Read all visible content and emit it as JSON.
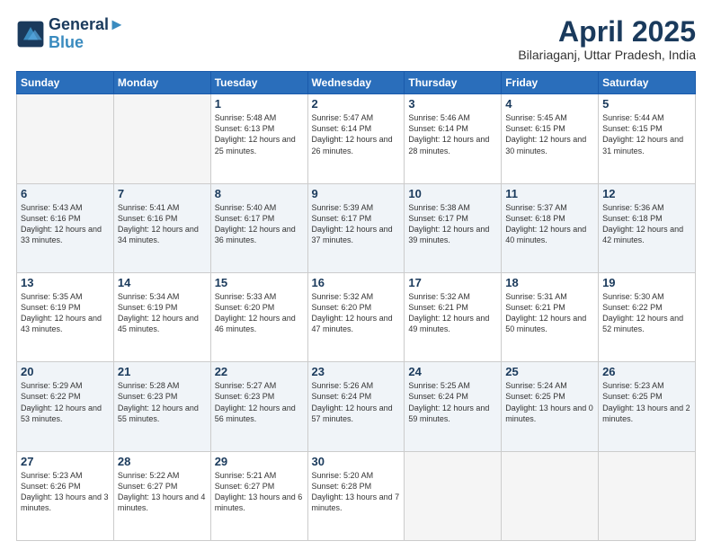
{
  "header": {
    "logo_line1": "General",
    "logo_line2": "Blue",
    "title": "April 2025",
    "subtitle": "Bilariaganj, Uttar Pradesh, India"
  },
  "days_of_week": [
    "Sunday",
    "Monday",
    "Tuesday",
    "Wednesday",
    "Thursday",
    "Friday",
    "Saturday"
  ],
  "weeks": [
    [
      {
        "day": "",
        "empty": true
      },
      {
        "day": "",
        "empty": true
      },
      {
        "day": "1",
        "sunrise": "5:48 AM",
        "sunset": "6:13 PM",
        "daylight": "12 hours and 25 minutes."
      },
      {
        "day": "2",
        "sunrise": "5:47 AM",
        "sunset": "6:14 PM",
        "daylight": "12 hours and 26 minutes."
      },
      {
        "day": "3",
        "sunrise": "5:46 AM",
        "sunset": "6:14 PM",
        "daylight": "12 hours and 28 minutes."
      },
      {
        "day": "4",
        "sunrise": "5:45 AM",
        "sunset": "6:15 PM",
        "daylight": "12 hours and 30 minutes."
      },
      {
        "day": "5",
        "sunrise": "5:44 AM",
        "sunset": "6:15 PM",
        "daylight": "12 hours and 31 minutes."
      }
    ],
    [
      {
        "day": "6",
        "sunrise": "5:43 AM",
        "sunset": "6:16 PM",
        "daylight": "12 hours and 33 minutes."
      },
      {
        "day": "7",
        "sunrise": "5:41 AM",
        "sunset": "6:16 PM",
        "daylight": "12 hours and 34 minutes."
      },
      {
        "day": "8",
        "sunrise": "5:40 AM",
        "sunset": "6:17 PM",
        "daylight": "12 hours and 36 minutes."
      },
      {
        "day": "9",
        "sunrise": "5:39 AM",
        "sunset": "6:17 PM",
        "daylight": "12 hours and 37 minutes."
      },
      {
        "day": "10",
        "sunrise": "5:38 AM",
        "sunset": "6:17 PM",
        "daylight": "12 hours and 39 minutes."
      },
      {
        "day": "11",
        "sunrise": "5:37 AM",
        "sunset": "6:18 PM",
        "daylight": "12 hours and 40 minutes."
      },
      {
        "day": "12",
        "sunrise": "5:36 AM",
        "sunset": "6:18 PM",
        "daylight": "12 hours and 42 minutes."
      }
    ],
    [
      {
        "day": "13",
        "sunrise": "5:35 AM",
        "sunset": "6:19 PM",
        "daylight": "12 hours and 43 minutes."
      },
      {
        "day": "14",
        "sunrise": "5:34 AM",
        "sunset": "6:19 PM",
        "daylight": "12 hours and 45 minutes."
      },
      {
        "day": "15",
        "sunrise": "5:33 AM",
        "sunset": "6:20 PM",
        "daylight": "12 hours and 46 minutes."
      },
      {
        "day": "16",
        "sunrise": "5:32 AM",
        "sunset": "6:20 PM",
        "daylight": "12 hours and 47 minutes."
      },
      {
        "day": "17",
        "sunrise": "5:32 AM",
        "sunset": "6:21 PM",
        "daylight": "12 hours and 49 minutes."
      },
      {
        "day": "18",
        "sunrise": "5:31 AM",
        "sunset": "6:21 PM",
        "daylight": "12 hours and 50 minutes."
      },
      {
        "day": "19",
        "sunrise": "5:30 AM",
        "sunset": "6:22 PM",
        "daylight": "12 hours and 52 minutes."
      }
    ],
    [
      {
        "day": "20",
        "sunrise": "5:29 AM",
        "sunset": "6:22 PM",
        "daylight": "12 hours and 53 minutes."
      },
      {
        "day": "21",
        "sunrise": "5:28 AM",
        "sunset": "6:23 PM",
        "daylight": "12 hours and 55 minutes."
      },
      {
        "day": "22",
        "sunrise": "5:27 AM",
        "sunset": "6:23 PM",
        "daylight": "12 hours and 56 minutes."
      },
      {
        "day": "23",
        "sunrise": "5:26 AM",
        "sunset": "6:24 PM",
        "daylight": "12 hours and 57 minutes."
      },
      {
        "day": "24",
        "sunrise": "5:25 AM",
        "sunset": "6:24 PM",
        "daylight": "12 hours and 59 minutes."
      },
      {
        "day": "25",
        "sunrise": "5:24 AM",
        "sunset": "6:25 PM",
        "daylight": "13 hours and 0 minutes."
      },
      {
        "day": "26",
        "sunrise": "5:23 AM",
        "sunset": "6:25 PM",
        "daylight": "13 hours and 2 minutes."
      }
    ],
    [
      {
        "day": "27",
        "sunrise": "5:23 AM",
        "sunset": "6:26 PM",
        "daylight": "13 hours and 3 minutes."
      },
      {
        "day": "28",
        "sunrise": "5:22 AM",
        "sunset": "6:27 PM",
        "daylight": "13 hours and 4 minutes."
      },
      {
        "day": "29",
        "sunrise": "5:21 AM",
        "sunset": "6:27 PM",
        "daylight": "13 hours and 6 minutes."
      },
      {
        "day": "30",
        "sunrise": "5:20 AM",
        "sunset": "6:28 PM",
        "daylight": "13 hours and 7 minutes."
      },
      {
        "day": "",
        "empty": true
      },
      {
        "day": "",
        "empty": true
      },
      {
        "day": "",
        "empty": true
      }
    ]
  ]
}
